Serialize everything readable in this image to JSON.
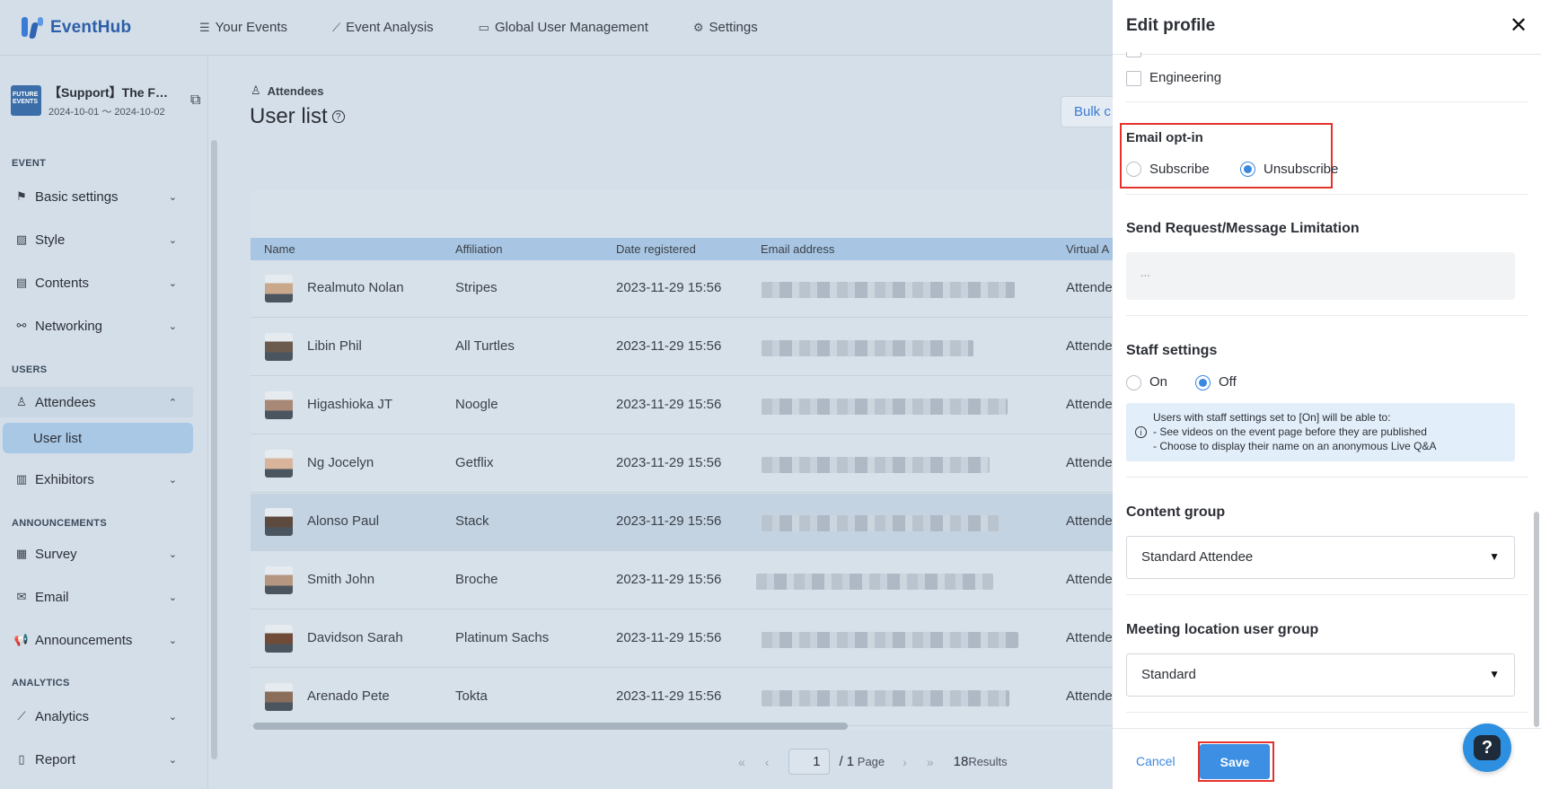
{
  "nav": {
    "logo": "EventHub",
    "items": [
      {
        "label": "Your Events",
        "icon": "list-icon"
      },
      {
        "label": "Event Analysis",
        "icon": "chart-icon"
      },
      {
        "label": "Global User Management",
        "icon": "id-card-icon"
      },
      {
        "label": "Settings",
        "icon": "gear-icon"
      }
    ]
  },
  "sidebar": {
    "event": {
      "title": "【Support】The F…",
      "dates": "2024-10-01 〜 2024-10-02",
      "thumb_text": "FUTURE EVENTS"
    },
    "sections": {
      "event": "EVENT",
      "users": "USERS",
      "announcements": "ANNOUNCEMENTS",
      "analytics": "ANALYTICS"
    },
    "items": {
      "basic_settings": "Basic settings",
      "style": "Style",
      "contents": "Contents",
      "networking": "Networking",
      "attendees": "Attendees",
      "user_list": "User list",
      "exhibitors": "Exhibitors",
      "survey": "Survey",
      "email": "Email",
      "announcements": "Announcements",
      "analytics": "Analytics",
      "report": "Report"
    }
  },
  "main": {
    "breadcrumb": "Attendees",
    "title": "User list",
    "bulk_button": "Bulk c",
    "columns": [
      "Name",
      "Affiliation",
      "Date registered",
      "Email address",
      "Virtual A"
    ],
    "rows": [
      {
        "name": "Realmuto Nolan",
        "affiliation": "Stripes",
        "date": "2023-11-29 15:56",
        "type": "Attende"
      },
      {
        "name": "Libin Phil",
        "affiliation": "All Turtles",
        "date": "2023-11-29 15:56",
        "type": "Attende"
      },
      {
        "name": "Higashioka JT",
        "affiliation": "Noogle",
        "date": "2023-11-29 15:56",
        "type": "Attende"
      },
      {
        "name": "Ng Jocelyn",
        "affiliation": "Getflix",
        "date": "2023-11-29 15:56",
        "type": "Attende"
      },
      {
        "name": "Alonso Paul",
        "affiliation": "Stack",
        "date": "2023-11-29 15:56",
        "type": "Attende"
      },
      {
        "name": "Smith John",
        "affiliation": "Broche",
        "date": "2023-11-29 15:56",
        "type": "Attende"
      },
      {
        "name": "Davidson Sarah",
        "affiliation": "Platinum Sachs",
        "date": "2023-11-29 15:56",
        "type": "Attende"
      },
      {
        "name": "Arenado Pete",
        "affiliation": "Tokta",
        "date": "2023-11-29 15:56",
        "type": "Attende"
      }
    ],
    "pager": {
      "page": "1",
      "of_pages": "/ 1",
      "page_word": "Page",
      "results_count": "18",
      "results_word": "Results"
    }
  },
  "panel": {
    "title": "Edit profile",
    "group_option": "Engineering",
    "email_optin": {
      "label": "Email opt-in",
      "subscribe": "Subscribe",
      "unsubscribe": "Unsubscribe",
      "selected": "Unsubscribe"
    },
    "limitation": {
      "label": "Send Request/Message Limitation",
      "placeholder": "..."
    },
    "staff": {
      "label": "Staff settings",
      "on": "On",
      "off": "Off",
      "selected": "Off",
      "info_lines": [
        "Users with staff settings set to [On] will be able to:",
        "- See videos on the event page before they are published",
        "- Choose to display their name on an anonymous Live Q&A"
      ]
    },
    "content_group": {
      "label": "Content group",
      "value": "Standard Attendee"
    },
    "meeting_group": {
      "label": "Meeting location user group",
      "value": "Standard"
    },
    "cancel": "Cancel",
    "save": "Save"
  },
  "colors": {
    "accent": "#3a87e0",
    "highlight": "#e4322b",
    "overlay_bg": "#d5dfe9"
  }
}
